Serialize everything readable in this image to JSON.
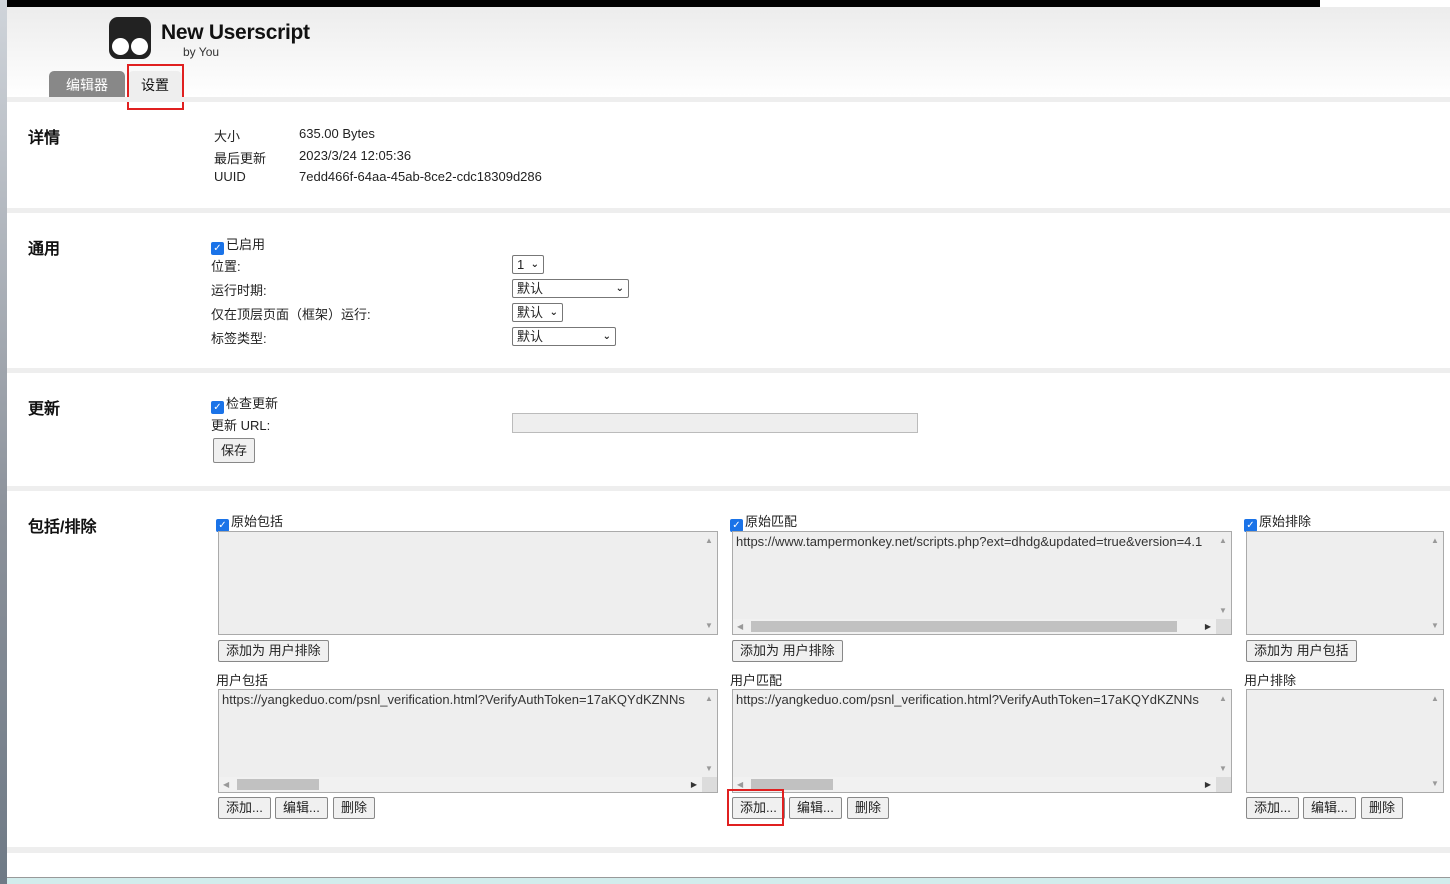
{
  "header": {
    "title": "New Userscript",
    "byline": "by You"
  },
  "tabs": [
    {
      "label": "编辑器",
      "active": false
    },
    {
      "label": "设置",
      "active": true
    }
  ],
  "details": {
    "heading": "详情",
    "rows": [
      {
        "label": "大小",
        "value": "635.00 Bytes"
      },
      {
        "label": "最后更新",
        "value": "2023/3/24 12:05:36"
      },
      {
        "label": "UUID",
        "value": "7edd466f-64aa-45ab-8ce2-cdc18309d286"
      }
    ]
  },
  "general": {
    "heading": "通用",
    "enabled_label": "已启用",
    "enabled": true,
    "fields": [
      {
        "label": "位置:",
        "value": "1"
      },
      {
        "label": "运行时期:",
        "value": "默认"
      },
      {
        "label": "仅在顶层页面（框架）运行:",
        "value": "默认"
      },
      {
        "label": "标签类型:",
        "value": "默认"
      }
    ]
  },
  "update": {
    "heading": "更新",
    "check_label": "检查更新",
    "checked": true,
    "url_label": "更新 URL:",
    "url_value": "",
    "save_label": "保存"
  },
  "include_exclude": {
    "heading": "包括/排除",
    "columns": [
      {
        "orig_label": "原始包括",
        "checked": true,
        "orig_value": "",
        "orig_button": "添加为 用户排除",
        "user_label": "用户包括",
        "user_value": "https://yangkeduo.com/psnl_verification.html?VerifyAuthToken=17aKQYdKZNNs",
        "buttons": [
          "添加...",
          "编辑...",
          "删除"
        ]
      },
      {
        "orig_label": "原始匹配",
        "checked": true,
        "orig_value": "https://www.tampermonkey.net/scripts.php?ext=dhdg&updated=true&version=4.1",
        "orig_button": "添加为 用户排除",
        "user_label": "用户匹配",
        "user_value": "https://yangkeduo.com/psnl_verification.html?VerifyAuthToken=17aKQYdKZNNs",
        "buttons": [
          "添加...",
          "编辑...",
          "删除"
        ]
      },
      {
        "orig_label": "原始排除",
        "checked": true,
        "orig_value": "",
        "orig_button": "添加为 用户包括",
        "user_label": "用户排除",
        "user_value": "",
        "buttons": [
          "添加...",
          "编辑...",
          "删除"
        ]
      }
    ]
  },
  "highlight_color": "#e02020",
  "checkbox_color": "#1a73e8"
}
